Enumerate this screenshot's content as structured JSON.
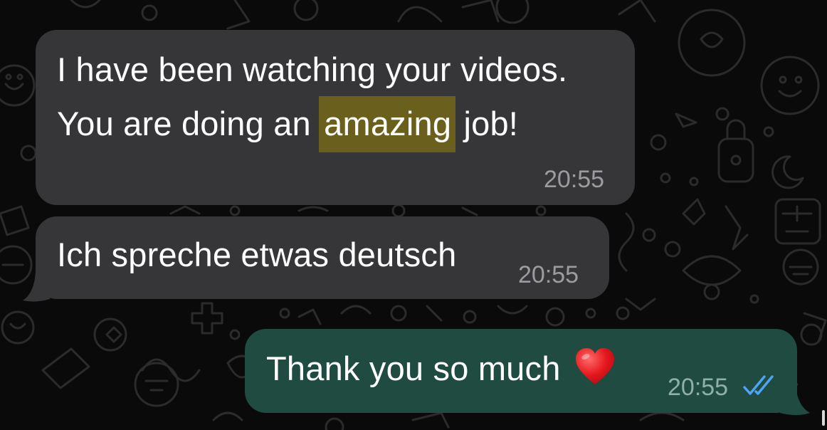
{
  "messages": [
    {
      "direction": "incoming",
      "line1": "I have been watching your videos.",
      "line2_before": "You are doing an ",
      "line2_highlight": "amazing",
      "line2_after": " job!",
      "time": "20:55"
    },
    {
      "direction": "incoming",
      "text": "Ich spreche etwas deutsch",
      "time": "20:55"
    },
    {
      "direction": "outgoing",
      "text": "Thank you so much",
      "emoji": "heart-emoji",
      "time": "20:55",
      "status": "read-double-check-icon"
    }
  ],
  "colors": {
    "incoming_bubble": "#363638",
    "outgoing_bubble": "#1f4b41",
    "highlight": "#6b5f1e",
    "read_ticks": "#4fa3f7"
  }
}
